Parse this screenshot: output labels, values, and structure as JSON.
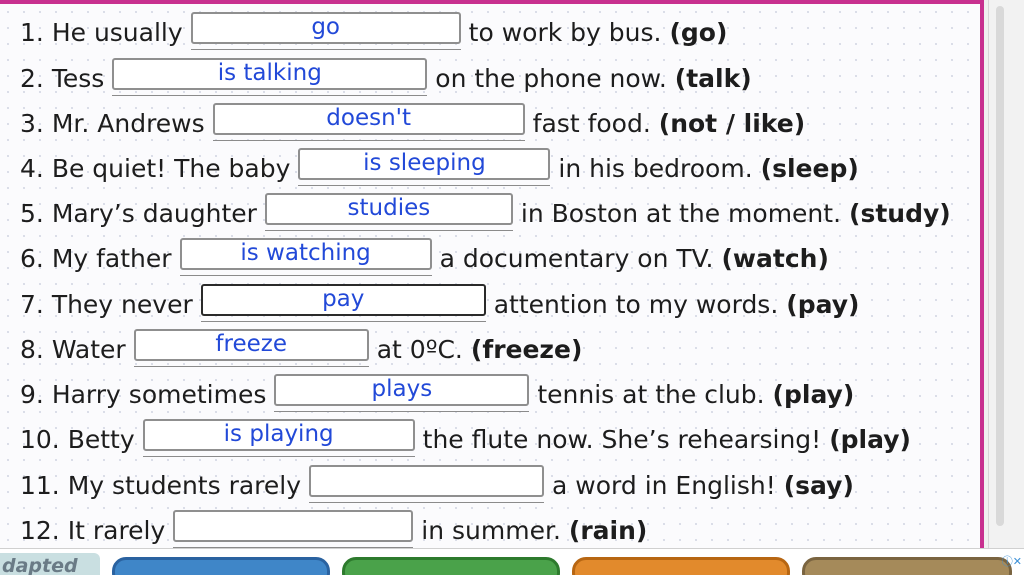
{
  "exercise": {
    "items": [
      {
        "num": "1.",
        "before": "He usually",
        "answer": "go",
        "after": "to work by bus.",
        "hint": "(go)"
      },
      {
        "num": "2.",
        "before": "Tess",
        "answer": "is talking",
        "after": "on the phone now.",
        "hint": "(talk)"
      },
      {
        "num": "3.",
        "before": "Mr. Andrews",
        "answer": "doesn't",
        "after": "fast food.",
        "hint": "(not / like)"
      },
      {
        "num": "4.",
        "before": "Be quiet! The baby",
        "answer": "is sleeping",
        "after": "in his bedroom.",
        "hint": "(sleep)"
      },
      {
        "num": "5.",
        "before": "Mary’s daughter",
        "answer": "studies",
        "after": "in Boston at the moment.",
        "hint": "(study)"
      },
      {
        "num": "6.",
        "before": "My father",
        "answer": "is watching",
        "after": "a documentary on TV.",
        "hint": "(watch)"
      },
      {
        "num": "7.",
        "before": "They never",
        "answer": "pay",
        "after": "attention to my words.",
        "hint": "(pay)"
      },
      {
        "num": "8.",
        "before": "Water",
        "answer": "freeze",
        "after": "at 0ºC.",
        "hint": "(freeze)"
      },
      {
        "num": "9.",
        "before": "Harry sometimes",
        "answer": "plays",
        "after": "tennis at the club.",
        "hint": "(play)"
      },
      {
        "num": "10.",
        "before": "Betty",
        "answer": "is playing",
        "after": "the flute now. She’s rehearsing!",
        "hint": "(play)"
      },
      {
        "num": "11.",
        "before": "My students rarely",
        "answer": "",
        "after": "a word in English!",
        "hint": "(say)"
      },
      {
        "num": "12.",
        "before": "It rarely",
        "answer": "",
        "after": "in summer.",
        "hint": "(rain)"
      }
    ]
  },
  "footer": {
    "logo_text": "dapted",
    "ad_close": "ⓘ✕"
  },
  "colors": {
    "answer_text": "#2249d8",
    "frame_border": "#c8308f"
  }
}
